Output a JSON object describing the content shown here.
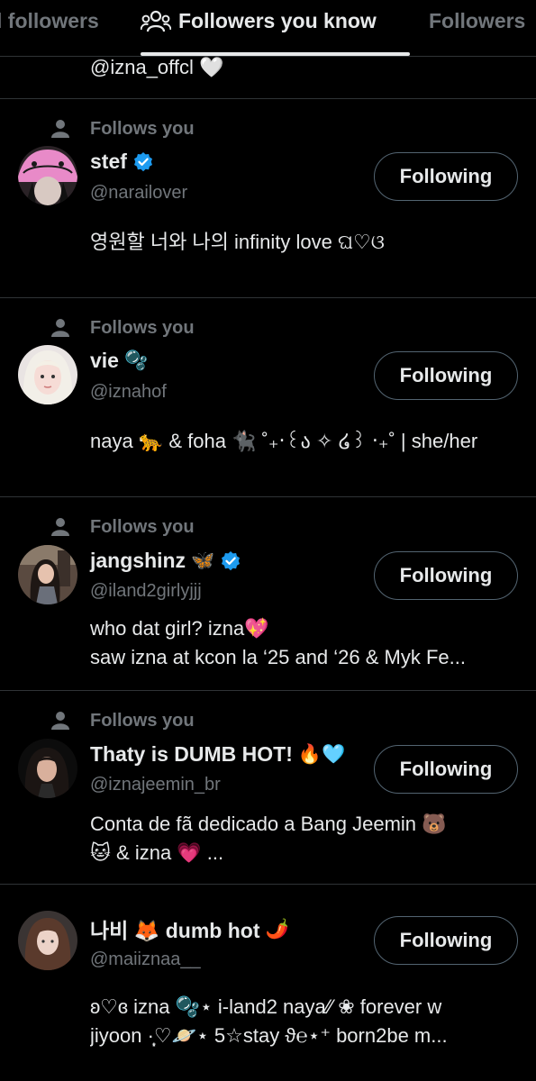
{
  "tabs": [
    {
      "label": "l followers"
    },
    {
      "label": "Followers you know",
      "icon": "people-icon",
      "active": true
    },
    {
      "label": "Followers"
    }
  ],
  "partial_row": {
    "text": "@izna_offcl 🤍"
  },
  "follows_label": "Follows you",
  "button_label": "Following",
  "colors": {
    "background": "#000000",
    "text": "#e7e9ea",
    "muted": "#71767b",
    "divider": "#2f3336",
    "verified": "#1d9bf0"
  },
  "users": [
    {
      "follows_you": "Follows you",
      "name": "stef",
      "verified": true,
      "emoji": "",
      "handle": "@narailover",
      "bio": [
        "영원할 너와 나의 infinity love ଘ♡ଓ"
      ],
      "button": "Following"
    },
    {
      "follows_you": "Follows you",
      "name": "vie",
      "verified": false,
      "emoji": "🫧",
      "handle": "@iznahof",
      "bio": [
        "naya 🐆 & foha 🐈‍⬛ ˚₊‧꒰ა ✧ ໒꒱ ‧₊˚ | she/her"
      ],
      "button": "Following"
    },
    {
      "follows_you": "Follows you",
      "name": "jangshinz",
      "verified": true,
      "emoji": "🦋",
      "handle": "@iland2girlyjjj",
      "bio": [
        "who dat girl? izna💖",
        "saw izna at kcon la ‘25 and ‘26 & Myk Fe..."
      ],
      "button": "Following"
    },
    {
      "follows_you": "Follows you",
      "name": "Thaty is DUMB HOT!",
      "verified": false,
      "emoji": "🔥🩵",
      "handle": "@iznajeemin_br",
      "bio": [
        "Conta de fã dedicado a Bang Jeemin 🐻",
        "🐱 & izna 💗 ..."
      ],
      "button": "Following"
    },
    {
      "follows_you": "",
      "name": "나비 🦊 dumb hot",
      "verified": false,
      "emoji": "🌶️",
      "handle": "@maiiznaa__",
      "bio": [
        "ʚ♡ɞ izna 🫧⋆ i-land2 naya⁄⁄ ❀ forever w",
        "jiyoon ·̩͙♡🪐⋆ 5☆stay ϑ℮⋆⁺ born2be m..."
      ],
      "button": "Following"
    }
  ]
}
